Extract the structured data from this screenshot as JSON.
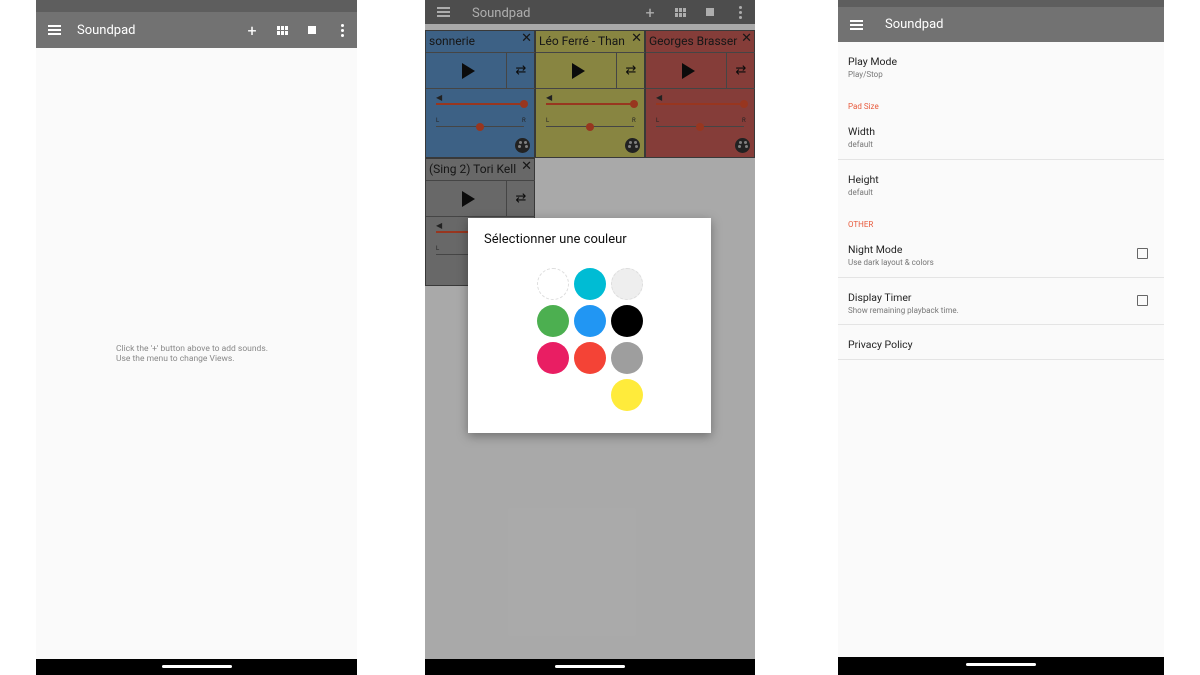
{
  "app": {
    "title": "Soundpad"
  },
  "toolbar": {
    "add_label": "+"
  },
  "empty_state": {
    "line1": "Click the '+' button above to add sounds.",
    "line2": "Use the menu to change Views."
  },
  "pads": [
    {
      "title": "sonnerie",
      "color": "#5b8fc4"
    },
    {
      "title": "Léo Ferré - Than",
      "color": "#c9c561"
    },
    {
      "title": "Georges Brasser",
      "color": "#c45b55"
    },
    {
      "title": "(Sing 2) Tori Kell",
      "color": "#9a9a9a"
    }
  ],
  "pad_labels": {
    "left": "L",
    "right": "R"
  },
  "color_dialog": {
    "title": "Sélectionner une couleur",
    "colors": [
      "#ffffff",
      "#00bcd4",
      "#eeeeee",
      "#4caf50",
      "#2196f3",
      "#000000",
      "#e91e63",
      "#f44336",
      "#9e9e9e",
      "#ffeb3b"
    ]
  },
  "settings": {
    "play_mode": {
      "title": "Play Mode",
      "value": "Play/Stop"
    },
    "pad_size_category": "Pad Size",
    "width": {
      "title": "Width",
      "value": "default"
    },
    "height": {
      "title": "Height",
      "value": "default"
    },
    "other_category": "OTHER",
    "night_mode": {
      "title": "Night Mode",
      "summary": "Use dark layout & colors",
      "checked": false
    },
    "display_timer": {
      "title": "Display Timer",
      "summary": "Show remaining playback time.",
      "checked": false
    },
    "privacy": {
      "title": "Privacy Policy"
    }
  }
}
